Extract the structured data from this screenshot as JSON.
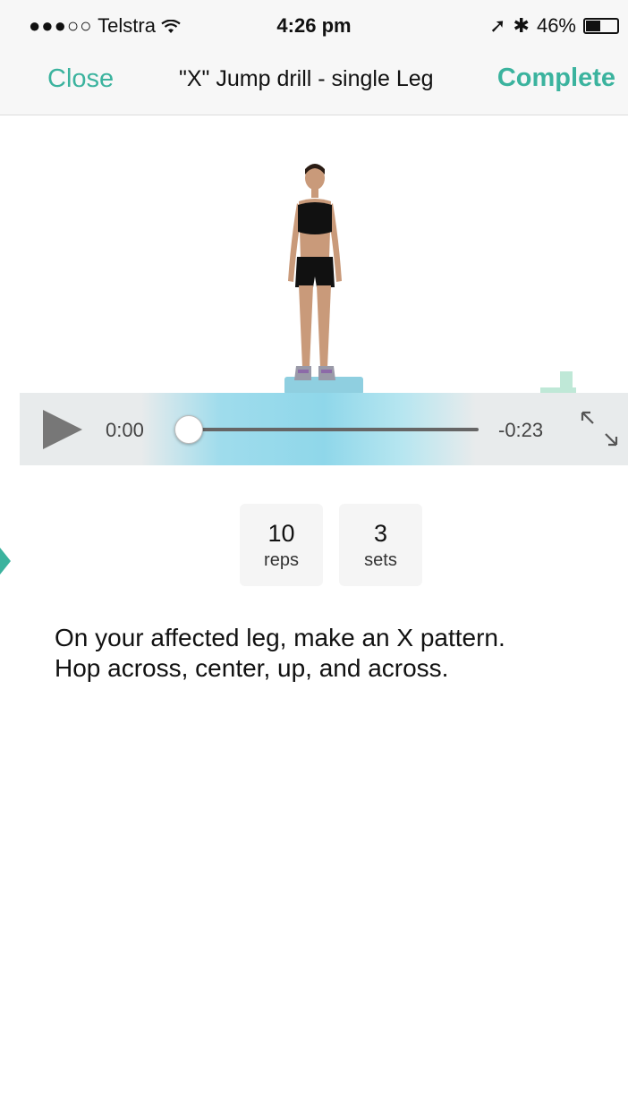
{
  "status_bar": {
    "signal_dots": "●●●○○",
    "carrier": "Telstra",
    "wifi_icon": "wifi-icon",
    "time": "4:26 pm",
    "location_icon": "➚",
    "bluetooth_icon": "✱",
    "battery_percent": "46%",
    "battery_level": 0.46
  },
  "nav": {
    "close_label": "Close",
    "title": "\"X\" Jump drill - single Leg",
    "complete_label": "Complete"
  },
  "video": {
    "current_time": "0:00",
    "remaining_time": "-0:23",
    "progress": 0
  },
  "stats": [
    {
      "value": "10",
      "label": "reps"
    },
    {
      "value": "3",
      "label": "sets"
    }
  ],
  "description": {
    "line1": "On your affected leg, make an X pattern.",
    "line2": "Hop across, center, up, and across."
  },
  "colors": {
    "accent": "#3bb39e",
    "video_highlight": "#8fd7ea"
  }
}
